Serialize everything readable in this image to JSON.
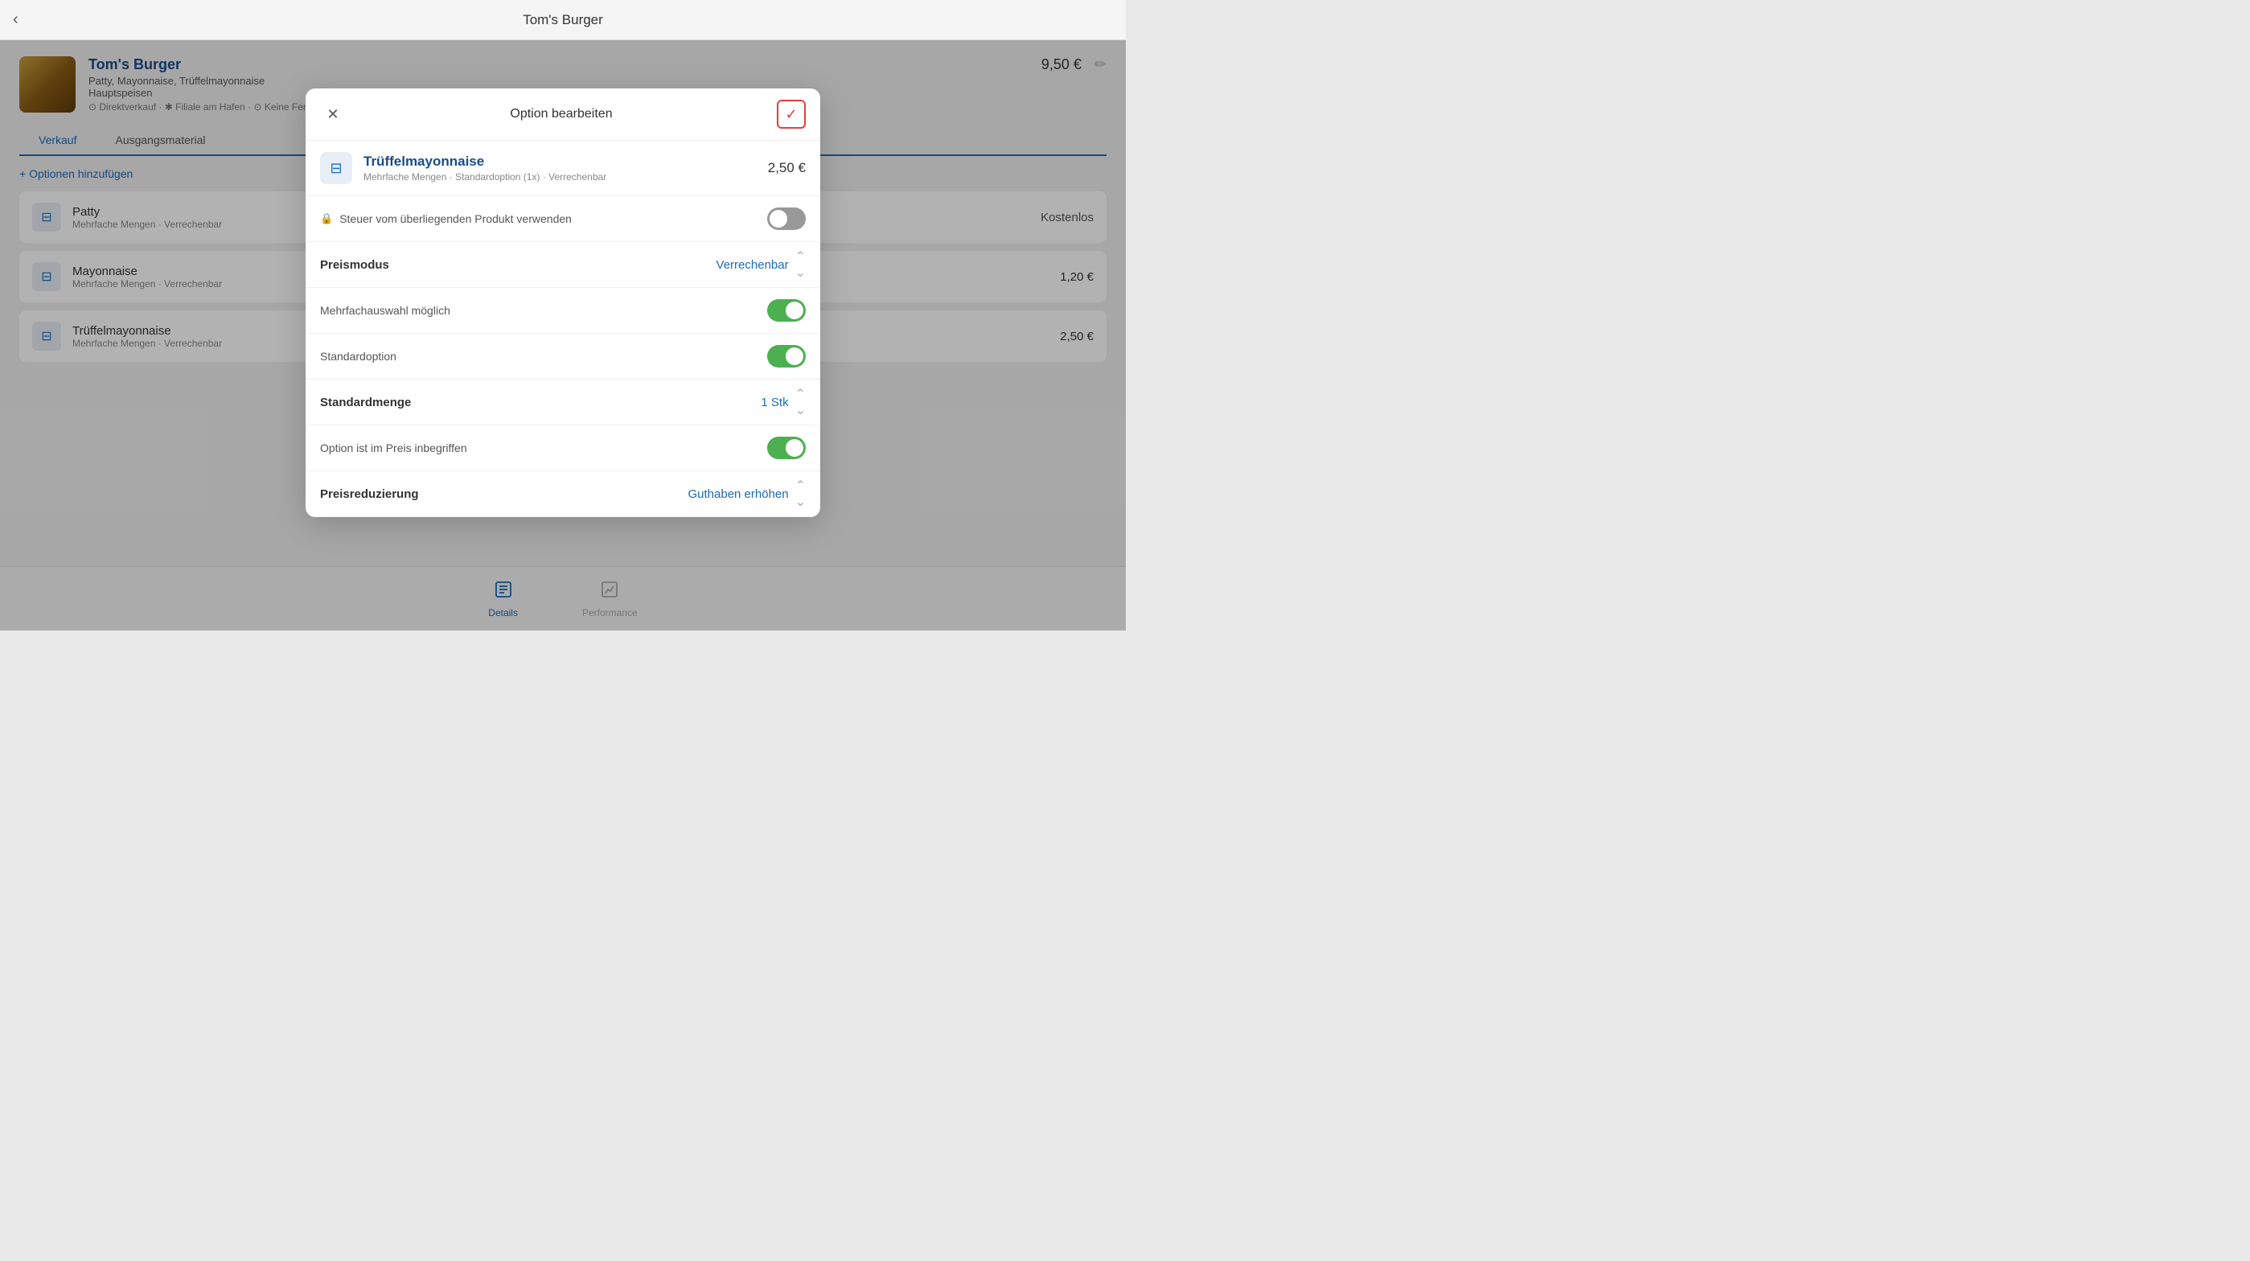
{
  "topBar": {
    "title": "Tom's Burger",
    "backLabel": "‹"
  },
  "product": {
    "name": "Tom's Burger",
    "ingredients": "Patty, Mayonnaise, Trüffelmayonnaise",
    "category": "Hauptspeisen",
    "tags": "⊙ Direktverkauf · ✱ Filiale am Hafen · ⊙ Keine Fert...",
    "price": "9,50 €"
  },
  "tabs": [
    {
      "label": "Verkauf",
      "active": true
    },
    {
      "label": "Ausgangsmaterial",
      "active": false
    }
  ],
  "addOptions": {
    "label": "+ Optionen hinzufügen"
  },
  "options": [
    {
      "name": "Patty",
      "sub": "Mehrfache Mengen · Verrechenbar",
      "price": "Kostenlos"
    },
    {
      "name": "Mayonnaise",
      "sub": "Mehrfache Mengen · Verrechenbar",
      "price": "1,20 €"
    },
    {
      "name": "Trüffelmayonnaise",
      "sub": "Mehrfache Mengen · Verrechenbar",
      "price": "2,50 €"
    }
  ],
  "modal": {
    "title": "Option bearbeiten",
    "closeLabel": "✕",
    "confirmLabel": "✓",
    "option": {
      "name": "Trüffelmayonnaise",
      "sub": "Mehrfache Mengen · Standardoption (1x) · Verrechenbar",
      "price": "2,50 €"
    },
    "rows": [
      {
        "type": "toggle-lock",
        "label": "Steuer vom überliegenden Produkt verwenden",
        "locked": true,
        "toggleState": "off"
      },
      {
        "type": "select",
        "label": "Preismodus",
        "value": "Verrechenbar"
      },
      {
        "type": "toggle",
        "label": "Mehrfachauswahl möglich",
        "toggleState": "on"
      },
      {
        "type": "toggle",
        "label": "Standardoption",
        "toggleState": "on"
      },
      {
        "type": "select",
        "label": "Standardmenge",
        "value": "1 Stk"
      },
      {
        "type": "toggle",
        "label": "Option ist im Preis inbegriffen",
        "toggleState": "on"
      },
      {
        "type": "select",
        "label": "Preisreduzierung",
        "value": "Guthaben erhöhen"
      }
    ]
  },
  "bottomNav": [
    {
      "label": "Details",
      "icon": "details",
      "active": true
    },
    {
      "label": "Performance",
      "icon": "performance",
      "active": false
    }
  ]
}
